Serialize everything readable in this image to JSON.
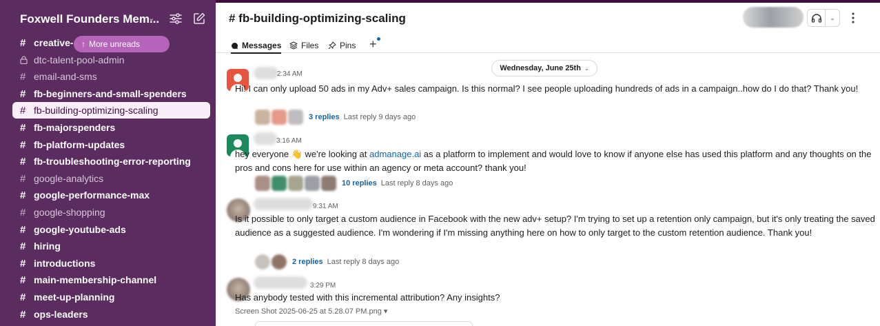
{
  "colors": {
    "sidebar_bg": "#5b2c5f",
    "active_item_bg": "#f8eff8",
    "more_unreads_bg": "#b564b9",
    "link": "#1264a3"
  },
  "sidebar": {
    "workspace_name": "Foxwell Founders Mem...",
    "more_unreads": "More unreads",
    "channels": [
      {
        "label": "creative-",
        "unread": true,
        "icon": "hash-icon"
      },
      {
        "label": "dtc-talent-pool-admin",
        "unread": false,
        "icon": "lock-icon"
      },
      {
        "label": "email-and-sms",
        "unread": false,
        "icon": "hash-icon"
      },
      {
        "label": "fb-beginners-and-small-spenders",
        "unread": true,
        "icon": "hash-icon"
      },
      {
        "label": "fb-building-optimizing-scaling",
        "unread": false,
        "active": true,
        "icon": "hash-icon"
      },
      {
        "label": "fb-majorspenders",
        "unread": true,
        "icon": "hash-icon"
      },
      {
        "label": "fb-platform-updates",
        "unread": true,
        "icon": "hash-icon"
      },
      {
        "label": "fb-troubleshooting-error-reporting",
        "unread": true,
        "icon": "hash-icon"
      },
      {
        "label": "google-analytics",
        "unread": false,
        "icon": "hash-icon"
      },
      {
        "label": "google-performance-max",
        "unread": true,
        "icon": "hash-icon"
      },
      {
        "label": "google-shopping",
        "unread": false,
        "icon": "hash-icon"
      },
      {
        "label": "google-youtube-ads",
        "unread": true,
        "icon": "hash-icon"
      },
      {
        "label": "hiring",
        "unread": true,
        "icon": "hash-icon"
      },
      {
        "label": "introductions",
        "unread": true,
        "icon": "hash-icon"
      },
      {
        "label": "main-membership-channel",
        "unread": true,
        "icon": "hash-icon"
      },
      {
        "label": "meet-up-planning",
        "unread": true,
        "icon": "hash-icon"
      },
      {
        "label": "ops-leaders",
        "unread": true,
        "icon": "hash-icon"
      }
    ]
  },
  "channel": {
    "title": "# fb-building-optimizing-scaling",
    "tabs": [
      {
        "label": "Messages",
        "icon": "message-icon"
      },
      {
        "label": "Files",
        "icon": "files-icon"
      },
      {
        "label": "Pins",
        "icon": "pin-icon"
      }
    ],
    "add_tab": "+"
  },
  "date_divider": "Wednesday, June 25th",
  "messages": [
    {
      "time": "2:34 AM",
      "text": "Hi! I can only upload 50 ads in my Adv+ sales campaign. Is this normal? I see people uploading hundreds of ads in a campaign..how do I do that? Thank you!",
      "thread": {
        "replies": "3 replies",
        "last": "Last reply 9 days ago"
      }
    },
    {
      "time": "3:16 AM",
      "text_before": "hey everyone ",
      "emoji": "👋",
      "text_mid": " we're looking at ",
      "link": "admanage.ai",
      "text_after": " as a platform to implement and would love to know if anyone else has used this platform and any thoughts on the pros and cons here for use within an agency or meta account? thank you!",
      "thread": {
        "replies": "10 replies",
        "last": "Last reply 8 days ago"
      }
    },
    {
      "time": "9:31 AM",
      "text": "Is it possible to only target a custom audience in Facebook with the new adv+ setup? I'm trying to set up a retention only campaign, but it's only treating the saved audience as a suggested audience. I'm wondering if I'm missing anything here on how to only target to the custom retention audience. Thank you!",
      "thread": {
        "replies": "2 replies",
        "last": "Last reply 8 days ago"
      }
    },
    {
      "time": "3:29 PM",
      "text": "Has anybody tested with this incremental attribution? Any insights?",
      "attachment": "Screen Shot 2025-06-25 at 5.28.07 PM.png"
    }
  ]
}
